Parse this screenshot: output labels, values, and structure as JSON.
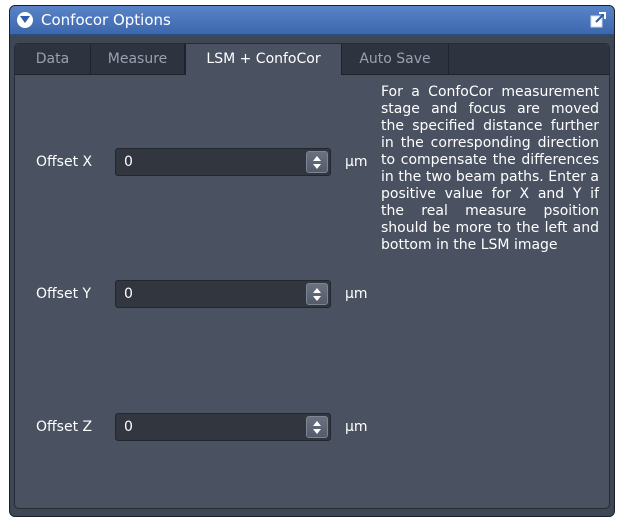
{
  "window": {
    "title": "Confocor Options"
  },
  "tabs": [
    {
      "label": "Data",
      "active": false
    },
    {
      "label": "Measure",
      "active": false
    },
    {
      "label": "LSM + ConfoCor",
      "active": true
    },
    {
      "label": "Auto Save",
      "active": false
    }
  ],
  "offsets": {
    "x": {
      "label": "Offset X",
      "value": "0",
      "unit": "µm"
    },
    "y": {
      "label": "Offset Y",
      "value": "0",
      "unit": "µm"
    },
    "z": {
      "label": "Offset Z",
      "value": "0",
      "unit": "µm"
    }
  },
  "help_text": "For a ConfoCor measurement stage and focus are moved the specified distance further in the corresponding direction to compensate the differences in the two beam paths. Enter a positive value for X and Y if the real measure psoition should be more to the left and bottom in the LSM image",
  "icons": {
    "collapse": "chevron-down-icon",
    "undock": "undock-icon",
    "spin": "spin-arrows-icon"
  },
  "colors": {
    "titlebar": "#4a76bd",
    "panel": "#4a5262",
    "tabbar": "#2e343f",
    "field": "#32373f",
    "text": "#ffffff"
  }
}
